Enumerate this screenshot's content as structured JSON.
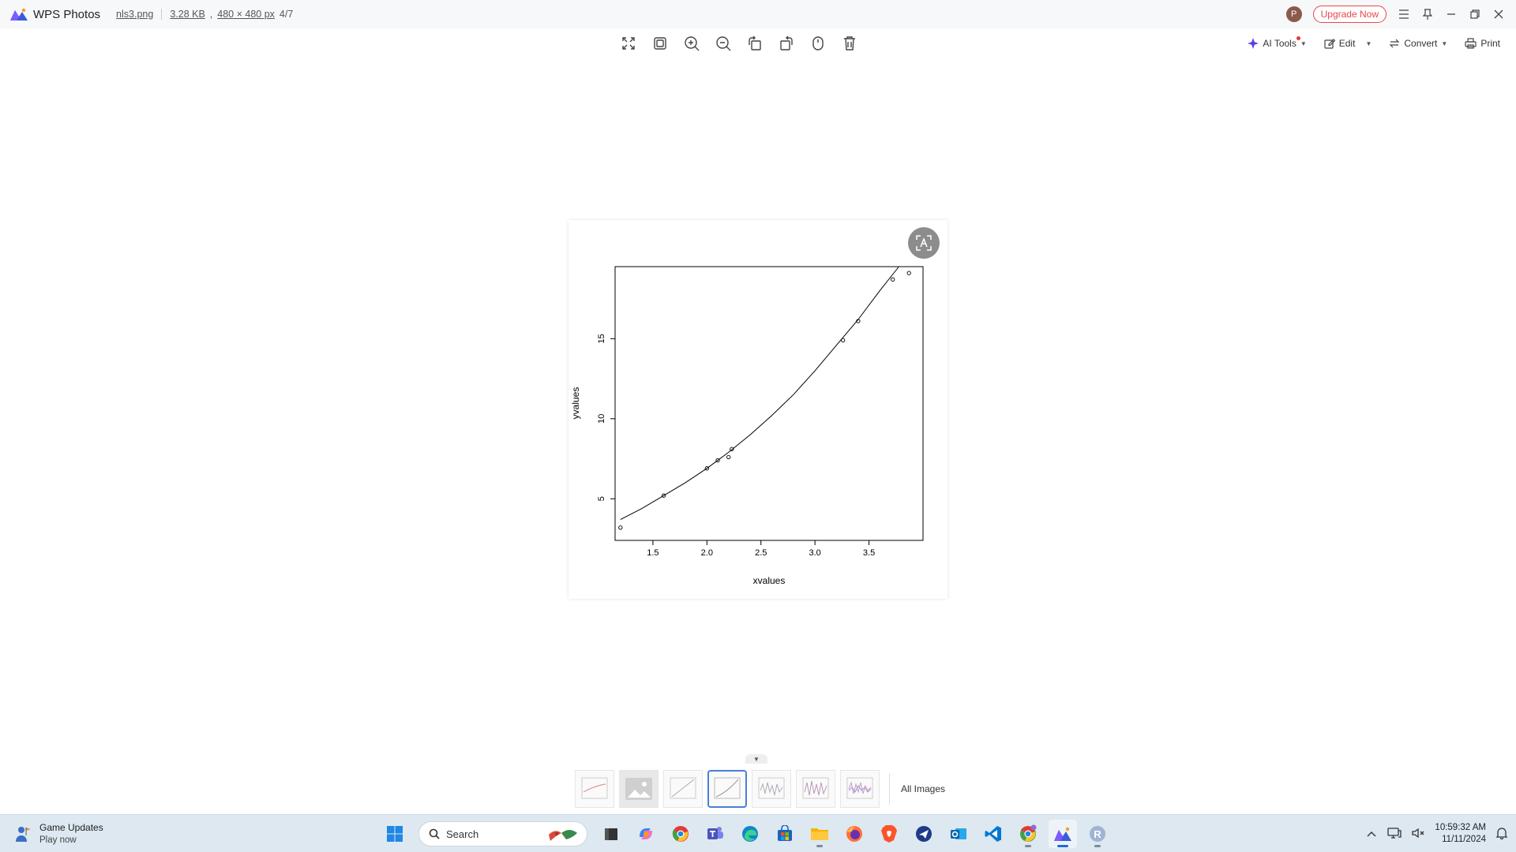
{
  "app": {
    "name": "WPS Photos",
    "file_name": "nls3.png",
    "file_size": "3.28 KB",
    "dimensions": "480 × 480 px",
    "position": "4/7",
    "upgrade_label": "Upgrade Now",
    "avatar_initial": "P"
  },
  "toolbar": {
    "tools": [
      "fullscreen-icon",
      "fit-window-icon",
      "zoom-in-icon",
      "zoom-out-icon",
      "rotate-left-icon",
      "rotate-right-icon",
      "mouse-icon",
      "delete-icon"
    ],
    "ai_tools_label": "AI Tools",
    "edit_label": "Edit",
    "convert_label": "Convert",
    "print_label": "Print"
  },
  "chart_data": {
    "type": "scatter",
    "xlabel": "xvalues",
    "ylabel": "yvalues",
    "xlim": [
      1.15,
      4.0
    ],
    "ylim": [
      2.4,
      19.5
    ],
    "xticks": [
      "1.5",
      "2.0",
      "2.5",
      "3.0",
      "3.5"
    ],
    "yticks": [
      "5",
      "10",
      "15"
    ],
    "points": {
      "x": [
        1.2,
        1.6,
        2.0,
        2.1,
        2.2,
        2.23,
        3.26,
        3.4,
        3.72,
        3.87
      ],
      "y": [
        3.2,
        5.2,
        6.9,
        7.4,
        7.6,
        8.1,
        14.9,
        16.1,
        18.7,
        19.1
      ]
    },
    "fit_line": {
      "x": [
        1.2,
        1.4,
        1.6,
        1.8,
        2.0,
        2.2,
        2.4,
        2.6,
        2.8,
        3.0,
        3.2,
        3.4,
        3.6,
        3.8,
        3.86
      ],
      "y": [
        3.7,
        4.4,
        5.2,
        6.0,
        6.9,
        7.9,
        9.0,
        10.2,
        11.5,
        13.0,
        14.6,
        16.2,
        18.0,
        19.7,
        20.2
      ]
    },
    "grid": false,
    "legend": "none"
  },
  "filmstrip": {
    "count": 7,
    "selected_index": 3,
    "all_images_label": "All Images"
  },
  "taskbar": {
    "news_title": "Game Updates",
    "news_subtitle": "Play now",
    "search_placeholder": "Search",
    "apps": [
      "windows-start-icon",
      "file-explorer-dark-icon",
      "copilot-icon",
      "chrome-icon",
      "teams-icon",
      "edge-icon",
      "store-icon",
      "folder-icon",
      "firefox-icon",
      "brave-icon",
      "mail-send-icon",
      "outlook-icon",
      "vscode-icon",
      "chrome-profile-icon",
      "wps-photos-icon",
      "r-icon"
    ],
    "time": "10:59:32 AM",
    "date": "11/11/2024"
  }
}
